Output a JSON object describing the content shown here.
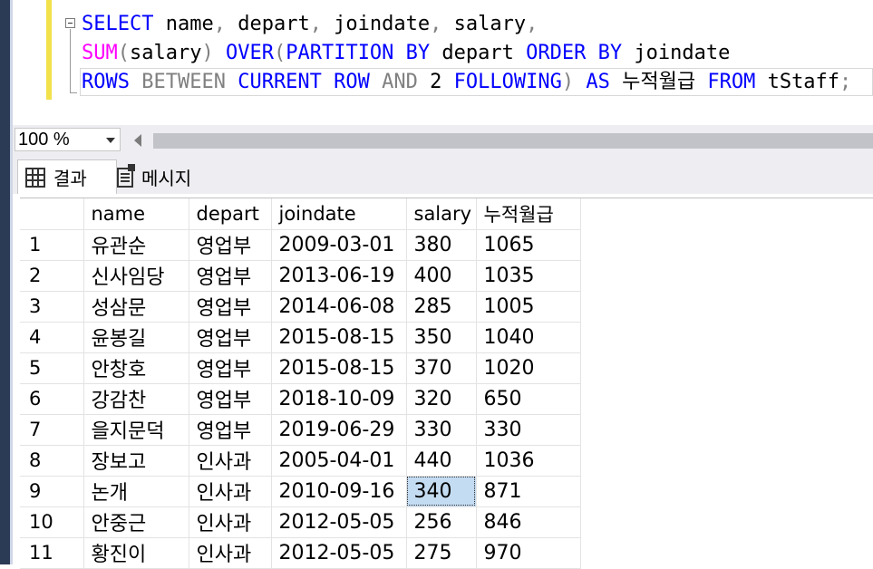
{
  "editor": {
    "lines": [
      [
        {
          "t": "SELECT",
          "c": "kw"
        },
        {
          "t": " ",
          "c": "tx"
        },
        {
          "t": "name",
          "c": "tx"
        },
        {
          "t": ",",
          "c": "gr"
        },
        {
          "t": " depart",
          "c": "tx"
        },
        {
          "t": ",",
          "c": "gr"
        },
        {
          "t": " joindate",
          "c": "tx"
        },
        {
          "t": ",",
          "c": "gr"
        },
        {
          "t": " salary",
          "c": "tx"
        },
        {
          "t": ",",
          "c": "gr"
        }
      ],
      [
        {
          "t": "SUM",
          "c": "fn"
        },
        {
          "t": "(",
          "c": "gr"
        },
        {
          "t": "salary",
          "c": "tx"
        },
        {
          "t": ")",
          "c": "gr"
        },
        {
          "t": " ",
          "c": "tx"
        },
        {
          "t": "OVER",
          "c": "kw"
        },
        {
          "t": "(",
          "c": "gr"
        },
        {
          "t": "PARTITION BY",
          "c": "kw"
        },
        {
          "t": " depart ",
          "c": "tx"
        },
        {
          "t": "ORDER BY",
          "c": "kw"
        },
        {
          "t": " joindate",
          "c": "tx"
        }
      ],
      [
        {
          "t": "ROWS",
          "c": "kw"
        },
        {
          "t": " ",
          "c": "tx"
        },
        {
          "t": "BETWEEN",
          "c": "gr"
        },
        {
          "t": " ",
          "c": "tx"
        },
        {
          "t": "CURRENT",
          "c": "kw"
        },
        {
          "t": " ",
          "c": "tx"
        },
        {
          "t": "ROW",
          "c": "kw"
        },
        {
          "t": " ",
          "c": "tx"
        },
        {
          "t": "AND",
          "c": "gr"
        },
        {
          "t": " 2 ",
          "c": "tx"
        },
        {
          "t": "FOLLOWING",
          "c": "kw"
        },
        {
          "t": ")",
          "c": "gr"
        },
        {
          "t": " ",
          "c": "tx"
        },
        {
          "t": "AS",
          "c": "kw"
        },
        {
          "t": " 누적월급 ",
          "c": "tx"
        },
        {
          "t": "FROM",
          "c": "kw"
        },
        {
          "t": " tStaff",
          "c": "tx"
        },
        {
          "t": ";",
          "c": "gr"
        }
      ]
    ]
  },
  "zoom": {
    "value": "100 %"
  },
  "tabs": {
    "results_label": "결과",
    "messages_label": "메시지"
  },
  "results": {
    "columns": [
      "",
      "name",
      "depart",
      "joindate",
      "salary",
      "누적월급"
    ],
    "rows": [
      [
        "1",
        "유관순",
        "영업부",
        "2009-03-01",
        "380",
        "1065"
      ],
      [
        "2",
        "신사임당",
        "영업부",
        "2013-06-19",
        "400",
        "1035"
      ],
      [
        "3",
        "성삼문",
        "영업부",
        "2014-06-08",
        "285",
        "1005"
      ],
      [
        "4",
        "윤봉길",
        "영업부",
        "2015-08-15",
        "350",
        "1040"
      ],
      [
        "5",
        "안창호",
        "영업부",
        "2015-08-15",
        "370",
        "1020"
      ],
      [
        "6",
        "강감찬",
        "영업부",
        "2018-10-09",
        "320",
        "650"
      ],
      [
        "7",
        "을지문덕",
        "영업부",
        "2019-06-29",
        "330",
        "330"
      ],
      [
        "8",
        "장보고",
        "인사과",
        "2005-04-01",
        "440",
        "1036"
      ],
      [
        "9",
        "논개",
        "인사과",
        "2010-09-16",
        "340",
        "871"
      ],
      [
        "10",
        "안중근",
        "인사과",
        "2012-05-05",
        "256",
        "846"
      ],
      [
        "11",
        "황진이",
        "인사과",
        "2012-05-05",
        "275",
        "970"
      ]
    ],
    "selected_cell": {
      "row": 8,
      "col": 4
    }
  }
}
